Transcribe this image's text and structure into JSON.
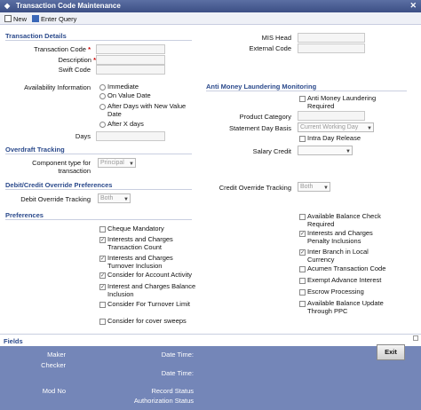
{
  "window": {
    "title": "Transaction Code Maintenance"
  },
  "toolbar": {
    "new_label": "New",
    "enter_query_label": "Enter Query"
  },
  "sections": {
    "transaction_details": "Transaction Details",
    "aml": "Anti Money Laundering Monitoring",
    "overdraft": "Overdraft Tracking",
    "debit_credit": "Debit/Credit Override Preferences",
    "preferences": "Preferences"
  },
  "fields": {
    "transaction_code": "Transaction Code",
    "description": "Description",
    "swift_code": "Swift Code",
    "mis_head": "MIS Head",
    "external_code": "External Code",
    "availability_information": "Availability Information",
    "days": "Days",
    "product_category": "Product Category",
    "statement_day_basis": "Statement Day Basis",
    "salary_credit": "Salary Credit",
    "component_type": "Component type for transaction",
    "debit_override_tracking": "Debit Override Tracking",
    "credit_override_tracking": "Credit Override Tracking",
    "required_marker": "*"
  },
  "availability_options": [
    "Immediate",
    "On Value Date",
    "After Days with New Value Date",
    "After X days"
  ],
  "aml": {
    "anti_money_laundering_required": "Anti Money Laundering Required",
    "intra_day_release": "Intra Day Release"
  },
  "selects": {
    "statement_day_basis": "Current Working Day",
    "salary_credit": "",
    "component_type": "Principal",
    "debit_override_tracking": "Both",
    "credit_override_tracking": "Both"
  },
  "preferences_left": [
    {
      "label": "Cheque Mandatory",
      "checked": false
    },
    {
      "label": "Interests and Charges Transaction Count",
      "checked": true
    },
    {
      "label": "Interests and Charges Turnover Inclusion",
      "checked": true
    },
    {
      "label": "Consider for Account Activity",
      "checked": true
    },
    {
      "label": "Interest and Charges Balance Inclusion",
      "checked": true
    },
    {
      "label": "Consider For Turnover Limit",
      "checked": false
    },
    {
      "label": "Consider for cover sweeps",
      "checked": false
    }
  ],
  "preferences_right": [
    {
      "label": "Available Balance Check Required",
      "checked": false
    },
    {
      "label": "Interests and Charges Penalty Inclusions",
      "checked": true
    },
    {
      "label": "Inter Branch in Local Currency",
      "checked": true
    },
    {
      "label": "Acumen Transaction Code",
      "checked": false
    },
    {
      "label": "Exempt Advance Interest",
      "checked": false
    },
    {
      "label": "Escrow Processing",
      "checked": false
    },
    {
      "label": "Available Balance Update Through PPC",
      "checked": false
    }
  ],
  "fields_bar": {
    "label": "Fields"
  },
  "footer": {
    "maker": "Maker",
    "checker": "Checker",
    "mod_no": "Mod No",
    "date_time_1": "Date Time:",
    "date_time_2": "Date Time:",
    "record_status": "Record Status",
    "authorization_status": "Authorization Status",
    "exit_label": "Exit"
  }
}
